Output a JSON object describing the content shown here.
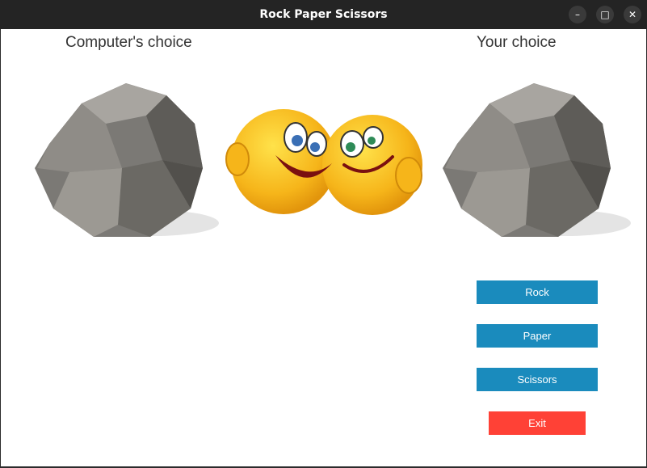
{
  "window": {
    "title": "Rock Paper Scissors",
    "controls": {
      "minimize_icon": "minimize-icon",
      "maximize_icon": "maximize-icon",
      "close_icon": "close-icon"
    }
  },
  "labels": {
    "computer_choice": "Computer's choice",
    "your_choice": "Your choice"
  },
  "images": {
    "computer_choice_image": "rock",
    "center_image": "hugging-emoji",
    "your_choice_image": "rock"
  },
  "buttons": {
    "rock": "Rock",
    "paper": "Paper",
    "scissors": "Scissors",
    "exit": "Exit"
  },
  "colors": {
    "button_blue": "#1a8bbd",
    "button_red": "#ff4136"
  }
}
